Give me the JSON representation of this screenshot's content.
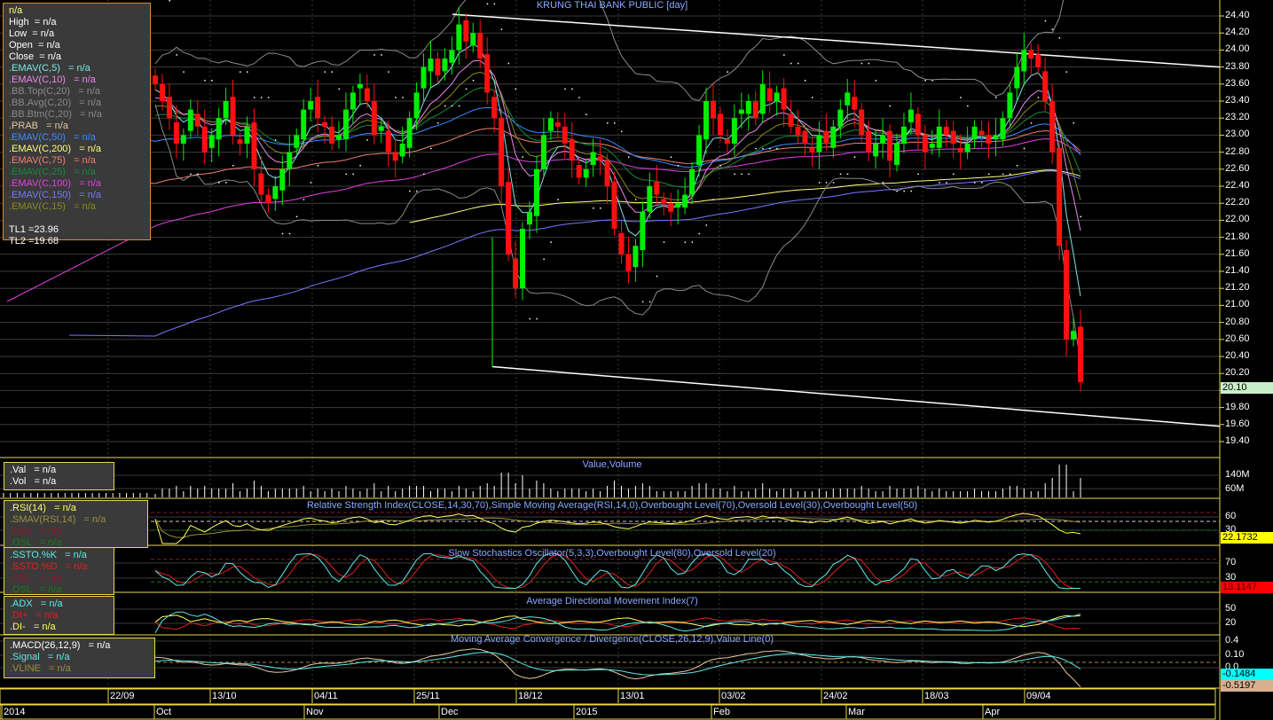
{
  "chart_data": {
    "type": "candlestick",
    "title": "KRUNG THAI BANK PUBLIC [day]",
    "ylim": [
      19.4,
      24.4
    ],
    "price_ticks": [
      "24.40",
      "24.20",
      "24.00",
      "23.80",
      "23.60",
      "23.40",
      "23.20",
      "23.00",
      "22.80",
      "22.60",
      "22.40",
      "22.20",
      "22.00",
      "21.80",
      "21.60",
      "21.40",
      "21.20",
      "21.00",
      "20.80",
      "20.60",
      "20.40",
      "20.20",
      "20.00",
      "19.80",
      "19.60",
      "19.40"
    ],
    "last_price": "20.10",
    "closes": [
      23.6,
      23.4,
      23.2,
      22.9,
      23.0,
      23.3,
      23.1,
      22.8,
      23.0,
      23.2,
      23.4,
      23.0,
      22.9,
      23.1,
      22.6,
      22.3,
      22.2,
      22.4,
      22.6,
      22.8,
      23.0,
      23.3,
      23.4,
      23.2,
      23.1,
      22.9,
      23.0,
      23.3,
      23.5,
      23.6,
      23.4,
      23.0,
      23.1,
      22.8,
      22.7,
      22.9,
      23.2,
      23.5,
      23.8,
      23.9,
      23.7,
      23.9,
      24.0,
      24.3,
      24.1,
      24.2,
      23.9,
      23.5,
      23.2,
      22.4,
      21.6,
      21.2,
      21.9,
      22.1,
      22.6,
      23.0,
      23.2,
      23.1,
      22.9,
      22.7,
      22.5,
      22.6,
      22.8,
      22.7,
      22.4,
      21.9,
      21.6,
      21.4,
      21.7,
      22.1,
      22.4,
      22.3,
      22.2,
      22.1,
      22.2,
      22.3,
      22.6,
      23.0,
      23.4,
      23.2,
      23.0,
      22.9,
      23.2,
      23.3,
      23.4,
      23.2,
      23.6,
      23.4,
      23.5,
      23.3,
      23.1,
      23.0,
      22.9,
      22.8,
      23.0,
      22.9,
      23.1,
      23.3,
      23.5,
      23.3,
      23.0,
      22.8,
      22.9,
      23.0,
      22.7,
      22.9,
      23.1,
      23.3,
      23.0,
      22.8,
      22.9,
      23.1,
      23.0,
      22.9,
      22.8,
      22.9,
      23.1,
      23.0,
      22.9,
      23.0,
      23.2,
      23.5,
      23.8,
      24.0,
      23.9,
      23.8,
      23.4,
      22.8,
      21.7,
      20.6,
      20.7,
      20.1
    ],
    "trendlines": {
      "TL1": 23.96,
      "TL2": 19.68
    },
    "x_ticks": [
      "22/09",
      "13/10",
      "04/11",
      "25/11",
      "18/12",
      "13/01",
      "03/02",
      "24/02",
      "18/03",
      "09/04"
    ],
    "x_months": [
      "2014",
      "Oct",
      "Nov",
      "Dec",
      "2015",
      "Feb",
      "Mar",
      "Apr"
    ],
    "panels": {
      "volume": {
        "title": "Value,Volume",
        "ticks": [
          "140M",
          "60M"
        ]
      },
      "rsi": {
        "title": "Relative Strength Index(CLOSE,14,30,70),Simple Moving Average(RSI,14,0),Overbought Level(70),Oversold Level(30),Overbought Level(50)",
        "ticks": [
          "60",
          "30"
        ],
        "last": "22.1732"
      },
      "ssto": {
        "title": "Slow Stochastics Oscillator(5,3,3),Overbought Level(80),Oversold Level(20)",
        "ticks": [
          "70",
          "30"
        ],
        "last": "13.1147"
      },
      "adx": {
        "title": "Average Directional Movement Index(7)",
        "ticks": [
          "50",
          "20"
        ]
      },
      "macd": {
        "title": "Moving Average Convergence / Divergence(CLOSE,26,12,9),Value Line(0)",
        "ticks": [
          "0.4",
          "0.10",
          "0.0"
        ],
        "last_macd": "-0.1484",
        "last_signal": "-0.5197"
      }
    }
  },
  "legend_main": [
    {
      "text": "n/a",
      "color": "#ffff80"
    },
    {
      "text": "High  = n/a",
      "color": "#ffffff"
    },
    {
      "text": "Low  = n/a",
      "color": "#ffffff"
    },
    {
      "text": "Open  = n/a",
      "color": "#ffffff"
    },
    {
      "text": "Close  = n/a",
      "color": "#ffffff"
    },
    {
      "text": ".EMAV(C,5)   = n/a",
      "color": "#7fe8e8"
    },
    {
      "text": ".EMAV(C,10)   = n/a",
      "color": "#ee88ee"
    },
    {
      "text": ".BB.Top(C,20)   = n/a",
      "color": "#8a8a8a"
    },
    {
      "text": ".BB.Avg(C,20)   = n/a",
      "color": "#8a8a8a"
    },
    {
      "text": ".BB.Btm(C,20)   = n/a",
      "color": "#8a8a8a"
    },
    {
      "text": ".PRAB   = n/a",
      "color": "#e8c8a0"
    },
    {
      "text": ".EMAV(C,50)   = n/a",
      "color": "#3a8cff"
    },
    {
      "text": ".EMAV(C,200)   = n/a",
      "color": "#ffff80"
    },
    {
      "text": ".EMAV(C,75)   = n/a",
      "color": "#f08070"
    },
    {
      "text": ".EMAV(C,25)   = n/a",
      "color": "#1a8a3a"
    },
    {
      "text": ".EMAV(C,100)   = n/a",
      "color": "#e040e0"
    },
    {
      "text": ".EMAV(C,150)   = n/a",
      "color": "#7878ff"
    },
    {
      "text": ".EMAV(C,15)   = n/a",
      "color": "#8a8a20"
    },
    {
      "text": "",
      "color": "#ffffff"
    },
    {
      "text": "TL1 =23.96",
      "color": "#ffffff"
    },
    {
      "text": "TL2 =19.68",
      "color": "#ffffff"
    }
  ],
  "legend_volume": [
    {
      "text": ".Val   = n/a",
      "color": "#ffffff"
    },
    {
      "text": ".Vol   = n/a",
      "color": "#ffffff"
    }
  ],
  "legend_rsi": [
    {
      "text": ".RSI(14)   = n/a",
      "color": "#ffff60"
    },
    {
      "text": ".SMAV(RSI,14)   = n/a",
      "color": "#9a9040"
    },
    {
      "text": ".OBL   = n/a",
      "color": "#8a1a2a"
    },
    {
      "text": ".OSL   = n/a",
      "color": "#1a7a1a"
    }
  ],
  "legend_ssto": [
    {
      "text": ".SSTO.%K   = n/a",
      "color": "#60e8e8"
    },
    {
      "text": ".SSTO.%D   = n/a",
      "color": "#e02020"
    },
    {
      "text": ".OBL   = n/a",
      "color": "#8a1a2a"
    },
    {
      "text": ".OSL   = n/a",
      "color": "#1a7a1a"
    }
  ],
  "legend_adx": [
    {
      "text": ".ADX   = n/a",
      "color": "#60e8e8"
    },
    {
      "text": ".DI+   = n/a",
      "color": "#e02020"
    },
    {
      "text": ".DI-   = n/a",
      "color": "#ffff60"
    }
  ],
  "legend_macd": [
    {
      "text": ".MACD(26,12,9)   = n/a",
      "color": "#ffffff"
    },
    {
      "text": ".Signal   = n/a",
      "color": "#60e8e8"
    },
    {
      "text": ".VLINE   = n/a",
      "color": "#9a9040"
    }
  ]
}
